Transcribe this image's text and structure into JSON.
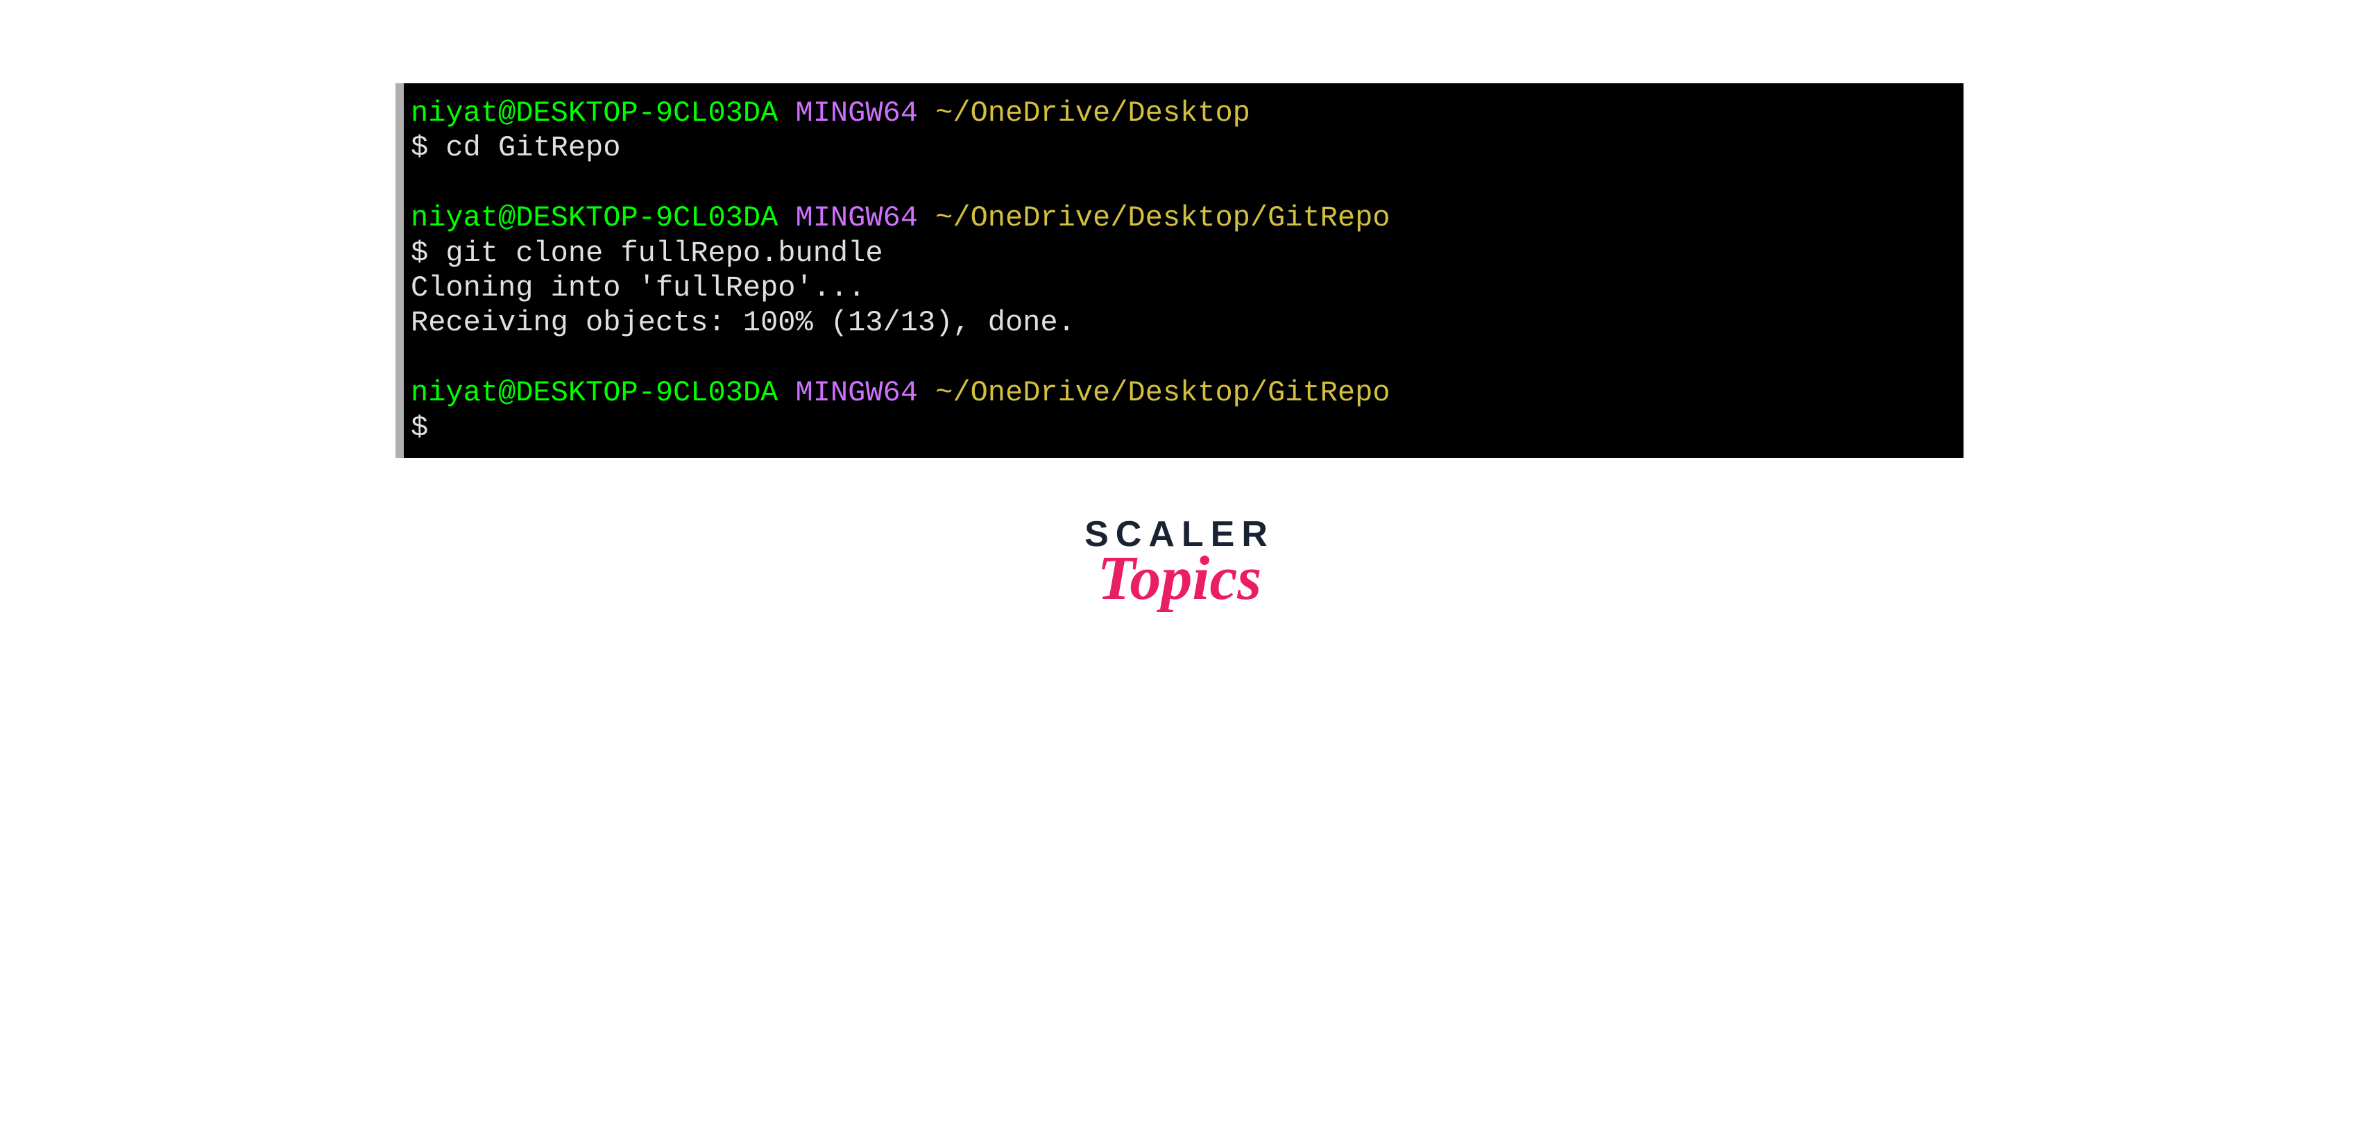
{
  "terminal": {
    "blocks": [
      {
        "user_host": "niyat@DESKTOP-9CL03DA",
        "shell": "MINGW64",
        "path": "~/OneDrive/Desktop",
        "prompt": "$",
        "command": "cd GitRepo",
        "output": []
      },
      {
        "user_host": "niyat@DESKTOP-9CL03DA",
        "shell": "MINGW64",
        "path": "~/OneDrive/Desktop/GitRepo",
        "prompt": "$",
        "command": "git clone fullRepo.bundle",
        "output": [
          "Cloning into 'fullRepo'...",
          "Receiving objects: 100% (13/13), done."
        ]
      },
      {
        "user_host": "niyat@DESKTOP-9CL03DA",
        "shell": "MINGW64",
        "path": "~/OneDrive/Desktop/GitRepo",
        "prompt": "$",
        "command": "",
        "output": []
      }
    ]
  },
  "logo": {
    "line1": "SCALER",
    "line2": "Topics"
  }
}
